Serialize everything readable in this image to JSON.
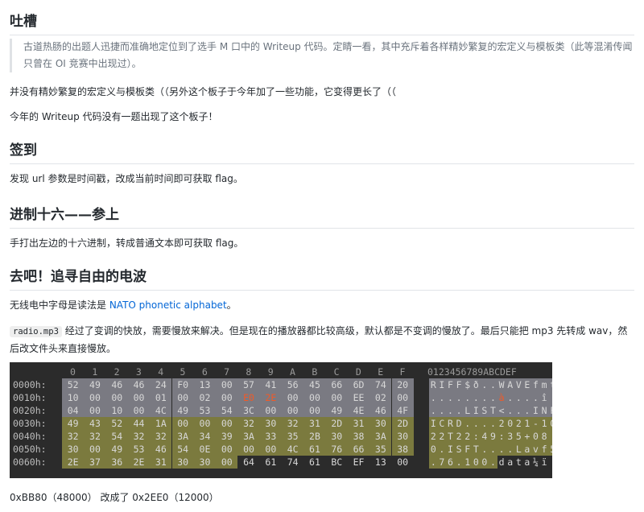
{
  "sections": {
    "tucao": {
      "heading": "吐槽",
      "quote": "古道热肠的出题人迅捷而准确地定位到了选手 M 口中的 Writeup 代码。定睛一看，其中充斥着各样精妙繁复的宏定义与模板类（此等混淆传闻只曾在 OI 竞赛中出现过）。",
      "para1": "并没有精妙繁复的宏定义与模板类（（另外这个板子于今年加了一些功能，它变得更长了（（",
      "para2": "今年的 Writeup 代码没有一题出现了这个板子！"
    },
    "qiandao": {
      "heading": "签到",
      "para": "发现 url 参数是时间戳，改成当前时间即可获取 flag。"
    },
    "hex16": {
      "heading": "进制十六——参上",
      "para": "手打出左边的十六进制，转成普通文本即可获取 flag。"
    },
    "radio": {
      "heading": "去吧！追寻自由的电波",
      "para_prefix": "无线电中字母是读法是 ",
      "link_text": "NATO phonetic alphabet",
      "para_suffix": "。",
      "code": "radio.mp3",
      "para2": " 经过了变调的快放，需要慢放来解决。但是现在的播放器都比较高级，默认都是不变调的慢放了。最后只能把 mp3 先转成 wav，然后改文件头来直接慢放。",
      "footer": "0xBB80（48000） 改成了 0x2EE0（12000）"
    }
  },
  "hex_editor": {
    "column_headers": [
      "0",
      "1",
      "2",
      "3",
      "4",
      "5",
      "6",
      "7",
      "8",
      "9",
      "A",
      "B",
      "C",
      "D",
      "E",
      "F"
    ],
    "ascii_header": "0123456789ABCDEF",
    "rows": [
      {
        "offset": "0000h:",
        "bytes": [
          "52",
          "49",
          "46",
          "46",
          "24",
          "F0",
          "13",
          "00",
          "57",
          "41",
          "56",
          "45",
          "66",
          "6D",
          "74",
          "20"
        ],
        "ascii": "RIFF$ð..WAVEfmt "
      },
      {
        "offset": "0010h:",
        "bytes": [
          "10",
          "00",
          "00",
          "00",
          "01",
          "00",
          "02",
          "00",
          "E0",
          "2E",
          "00",
          "00",
          "00",
          "EE",
          "02",
          "00"
        ],
        "ascii": "........à....î.."
      },
      {
        "offset": "0020h:",
        "bytes": [
          "04",
          "00",
          "10",
          "00",
          "4C",
          "49",
          "53",
          "54",
          "3C",
          "00",
          "00",
          "00",
          "49",
          "4E",
          "46",
          "4F"
        ],
        "ascii": "....LIST<...INFO"
      },
      {
        "offset": "0030h:",
        "bytes": [
          "49",
          "43",
          "52",
          "44",
          "1A",
          "00",
          "00",
          "00",
          "32",
          "30",
          "32",
          "31",
          "2D",
          "31",
          "30",
          "2D"
        ],
        "ascii": "ICRD....2021-10-"
      },
      {
        "offset": "0040h:",
        "bytes": [
          "32",
          "32",
          "54",
          "32",
          "32",
          "3A",
          "34",
          "39",
          "3A",
          "33",
          "35",
          "2B",
          "30",
          "38",
          "3A",
          "30"
        ],
        "ascii": "22T22:49:35+08:0"
      },
      {
        "offset": "0050h:",
        "bytes": [
          "30",
          "00",
          "49",
          "53",
          "46",
          "54",
          "0E",
          "00",
          "00",
          "00",
          "4C",
          "61",
          "76",
          "66",
          "35",
          "38"
        ],
        "ascii": "0.ISFT....Lavf58"
      },
      {
        "offset": "0060h:",
        "bytes": [
          "2E",
          "37",
          "36",
          "2E",
          "31",
          "30",
          "30",
          "00",
          "64",
          "61",
          "74",
          "61",
          "BC",
          "EF",
          "13",
          "00"
        ],
        "ascii": ".76.100.data¼ï.."
      }
    ],
    "colors": {
      "background": "#2b2b2b",
      "gray_highlight": "#7a7a82",
      "olive_highlight": "#7b7a3e",
      "modified_text": "#f05a28",
      "text": "#d8d8d8",
      "header_text": "#9a9a9a"
    }
  }
}
